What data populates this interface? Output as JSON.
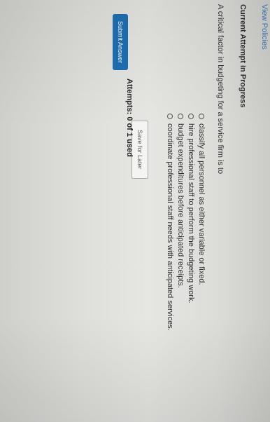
{
  "header": {
    "view_policies": "View Policies"
  },
  "attempt": {
    "status_heading": "Current Attempt in Progress"
  },
  "question": {
    "prompt": "A critical factor in budgeting for a service firm is to",
    "options": [
      "classify all personnel as either variable or fixed.",
      "hire professional staff to perform the budgeting work.",
      "budget expenditures before anticipated receipts.",
      "coordinate professional staff needs with anticipated services."
    ]
  },
  "actions": {
    "save_later": "Save for Later",
    "attempts_text": "Attempts: 0 of 1 used",
    "submit": "Submit Answer"
  }
}
